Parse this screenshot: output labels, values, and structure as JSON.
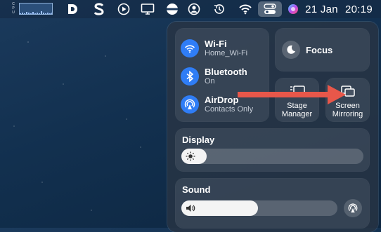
{
  "menubar": {
    "cpu_label": "CPU",
    "cpu_bars": [
      0.1,
      0.15,
      0.1,
      0.2,
      0.12,
      0.1,
      0.18,
      0.1,
      0.15,
      0.1,
      0.3,
      0.12,
      0.1,
      0.15,
      0.1,
      0.12
    ],
    "icons": [
      "d-app-icon",
      "s-app-icon",
      "play-icon",
      "display-icon",
      "vpn-icon",
      "user-icon",
      "time-machine-icon",
      "wifi-icon",
      "control-centre-icon",
      "siri-icon"
    ],
    "date": "21 Jan",
    "time": "20:19"
  },
  "control_centre": {
    "wifi": {
      "title": "Wi-Fi",
      "subtitle": "Home_Wi-Fi"
    },
    "bluetooth": {
      "title": "Bluetooth",
      "subtitle": "On"
    },
    "airdrop": {
      "title": "AirDrop",
      "subtitle": "Contacts Only"
    },
    "focus": {
      "label": "Focus"
    },
    "stage_manager": {
      "line1": "Stage",
      "line2": "Manager"
    },
    "screen_mirroring": {
      "line1": "Screen",
      "line2": "Mirroring"
    },
    "display": {
      "title": "Display",
      "brightness": 0.14
    },
    "sound": {
      "title": "Sound",
      "volume": 0.49
    }
  },
  "colors": {
    "accent": "#2f7df6",
    "arrow": "#e8574a"
  }
}
